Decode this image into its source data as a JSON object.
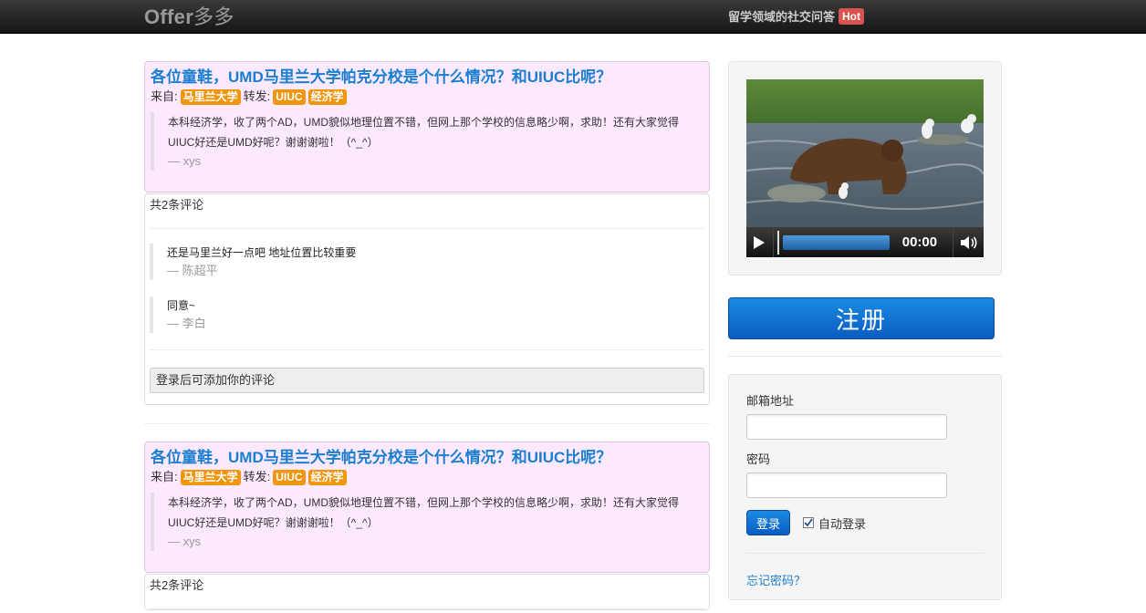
{
  "nav": {
    "brand_latin": "Offer",
    "brand_cn": "多多",
    "slogan": "留学领域的社交问答",
    "hot_badge": "Hot"
  },
  "posts": [
    {
      "title": "各位童鞋，UMD马里兰大学帕克分校是个什么情况？和UIUC比呢？",
      "from_label": "来自:",
      "from_tag": "马里兰大学",
      "forward_label": "转发:",
      "forward_tags": [
        "UIUC",
        "经济学"
      ],
      "body": "本科经济学，收了两个AD，UMD貌似地理位置不错，但网上那个学校的信息略少啊，求助！还有大家觉得UIUC好还是UMD好呢？谢谢谢啦！（^_^）",
      "author": "— xys",
      "comment_count": "共2条评论",
      "comments": [
        {
          "text": "还是马里兰好一点吧 地址位置比较重要",
          "author": "— 陈超平"
        },
        {
          "text": "同意~",
          "author": "— 李白"
        }
      ],
      "comment_placeholder": "登录后可添加你的评论"
    },
    {
      "title": "各位童鞋，UMD马里兰大学帕克分校是个什么情况？和UIUC比呢？",
      "from_label": "来自:",
      "from_tag": "马里兰大学",
      "forward_label": "转发:",
      "forward_tags": [
        "UIUC",
        "经济学"
      ],
      "body": "本科经济学，收了两个AD，UMD貌似地理位置不错，但网上那个学校的信息略少啊，求助！还有大家觉得UIUC好还是UMD好呢？谢谢谢啦！（^_^）",
      "author": "— xys",
      "comment_count": "共2条评论"
    }
  ],
  "video": {
    "time": "00:00",
    "progress_fraction": 0.0
  },
  "sidebar": {
    "register_label": "注册",
    "email_label": "邮箱地址",
    "password_label": "密码",
    "login_label": "登录",
    "remember_label": "自动登录",
    "remember_checked": true,
    "forgot_label": "忘记密码？"
  },
  "colors": {
    "link": "#1a7fd0",
    "tag": "#f0950e",
    "post_bg": "#fde9fd",
    "primary": "#0a5cc0",
    "hot": "#d9534f"
  }
}
